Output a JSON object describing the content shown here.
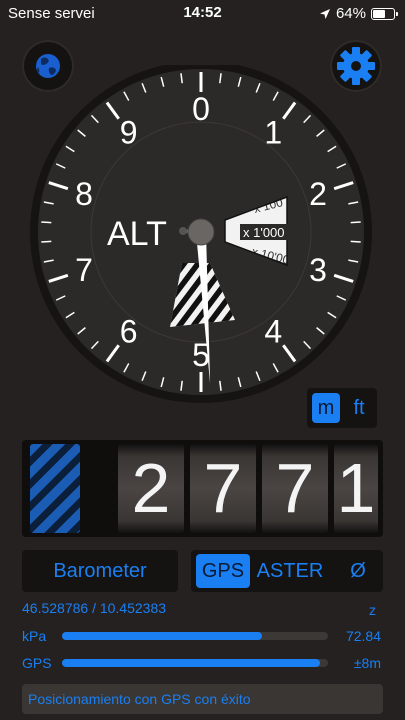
{
  "status_bar": {
    "carrier": "Sense servei",
    "time": "14:52",
    "battery_text": "64%",
    "battery_level": 0.64,
    "location_icon": "location-arrow-icon",
    "battery_icon": "battery-icon"
  },
  "top_buttons": {
    "globe_icon": "globe-icon",
    "settings_icon": "gear-icon"
  },
  "dial": {
    "numerals": [
      "0",
      "1",
      "2",
      "3",
      "4",
      "5",
      "6",
      "7",
      "8",
      "9"
    ],
    "center_label": "ALT",
    "window_labels": [
      "x 100",
      "x 1'000",
      "x 10'000"
    ],
    "altitude_m": 2771,
    "pointer_icon": "altimeter-needle"
  },
  "unit_toggle": {
    "metric": "m",
    "imperial": "ft",
    "selected": "m"
  },
  "counter": {
    "digits": [
      "2",
      "7",
      "7",
      "1"
    ]
  },
  "barometer_button": "Barometer",
  "source": {
    "gps": "GPS",
    "aster": "ASTER",
    "none": "Ø",
    "selected": "GPS"
  },
  "coordinates": "46.528786 / 10.452383",
  "z_label": "z",
  "readings": [
    {
      "label": "kPa",
      "value": "72.84",
      "level": 0.75
    },
    {
      "label": "GPS",
      "value": "±8m",
      "level": 0.97
    }
  ],
  "status_message": "Posicionamiento con GPS con éxito",
  "colors": {
    "accent": "#1a7ff3",
    "background": "#242120",
    "dial_face": "#2c2a29"
  }
}
